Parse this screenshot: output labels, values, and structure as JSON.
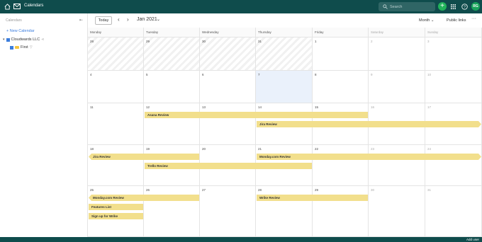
{
  "topbar": {
    "title": "Calendars",
    "search_placeholder": "Search",
    "plus_label": "+",
    "avatar_initials": "RG",
    "accent": "#0f4c4c",
    "plus_color": "#21b35a"
  },
  "sidebar": {
    "section_label": "Calendars",
    "new_calendar": "+ New Calendar",
    "org_name": "Cloudwards LLC",
    "calendar_name": "First"
  },
  "toolbar": {
    "today": "Today",
    "month_label": "Jan 2021",
    "view": "Month",
    "view_caret": "⌄",
    "public_links": "Public links",
    "more": "···"
  },
  "calendar": {
    "weekdays": [
      "Monday",
      "Tuesday",
      "Wednesday",
      "Thursday",
      "Friday",
      "Saturday",
      "Sunday"
    ],
    "weeks": [
      [
        "28",
        "29",
        "30",
        "31",
        "1",
        "2",
        "3"
      ],
      [
        "4",
        "5",
        "6",
        "7",
        "8",
        "9",
        "10"
      ],
      [
        "11",
        "12",
        "13",
        "14",
        "15",
        "16",
        "17"
      ],
      [
        "18",
        "19",
        "20",
        "21",
        "22",
        "23",
        "24"
      ],
      [
        "25",
        "26",
        "27",
        "28",
        "29",
        "30",
        "31"
      ]
    ],
    "events": [
      {
        "title": "Asana Review",
        "week": 2,
        "row": 0,
        "start": 1,
        "end": 5,
        "shape": "none"
      },
      {
        "title": "Jira Review",
        "week": 2,
        "row": 1,
        "start": 3,
        "end": 7,
        "shape": "right"
      },
      {
        "title": "Jira Review",
        "week": 3,
        "row": 0,
        "start": 0,
        "end": 2,
        "shape": "left"
      },
      {
        "title": "Monday.com Review",
        "week": 3,
        "row": 0,
        "start": 3,
        "end": 7,
        "shape": "right"
      },
      {
        "title": "Trello Review",
        "week": 3,
        "row": 1,
        "start": 1,
        "end": 4,
        "shape": "none"
      },
      {
        "title": "Monday.com Review",
        "week": 4,
        "row": 0,
        "start": 0,
        "end": 2,
        "shape": "left"
      },
      {
        "title": "Wrike Review",
        "week": 4,
        "row": 0,
        "start": 3,
        "end": 5,
        "shape": "none"
      },
      {
        "title": "Features List",
        "week": 4,
        "row": 1,
        "start": 0,
        "end": 1,
        "shape": "none"
      },
      {
        "title": "Sign up for Wrike",
        "week": 4,
        "row": 2,
        "start": 0,
        "end": 1,
        "shape": "none"
      }
    ]
  },
  "footer": {
    "version": "Add user"
  }
}
